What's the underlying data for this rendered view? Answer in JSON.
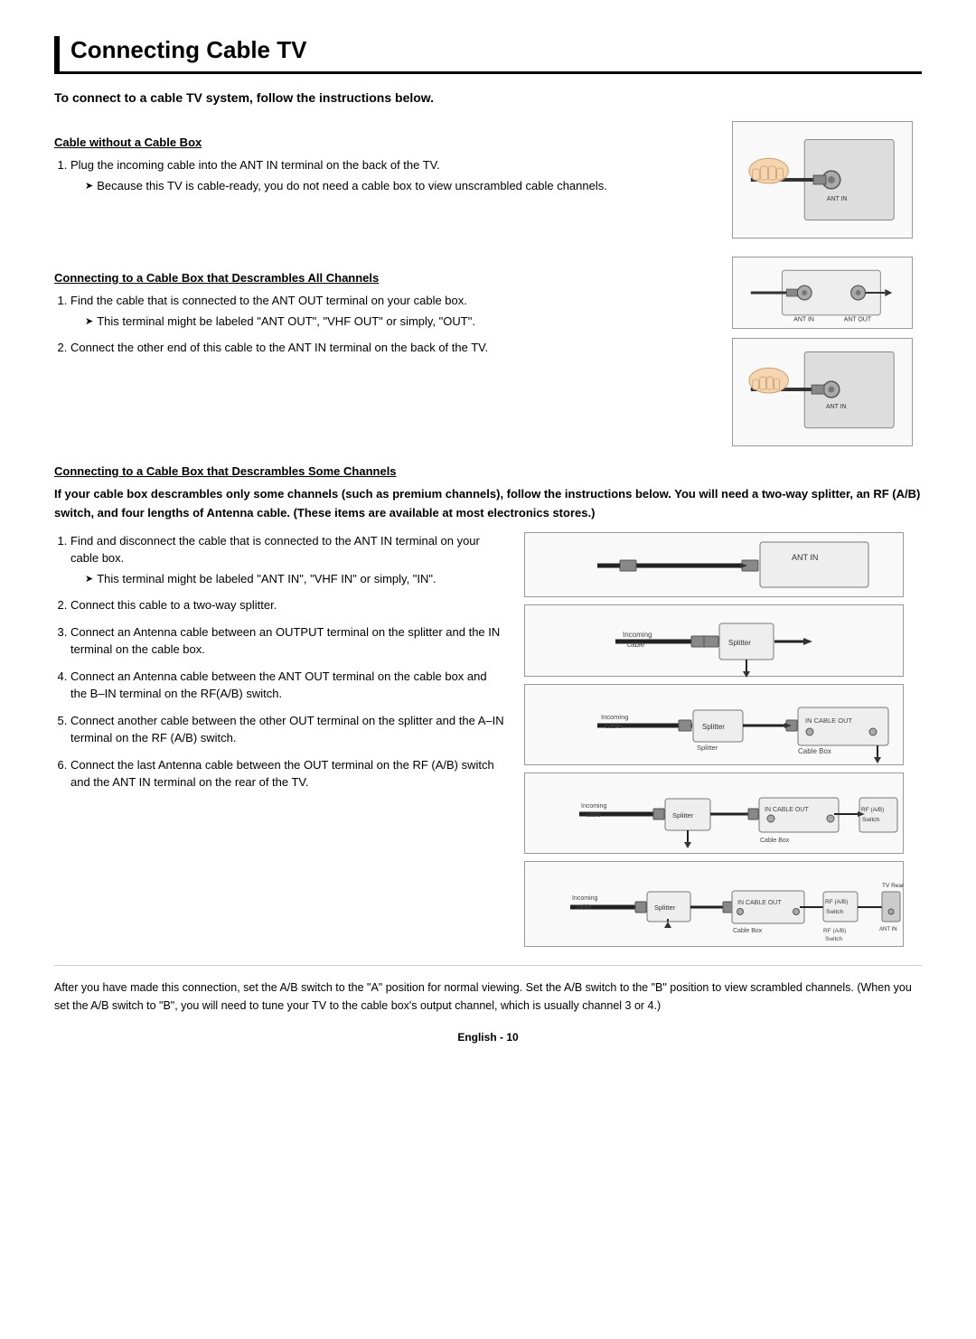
{
  "page": {
    "title": "Connecting Cable TV",
    "intro": "To connect to a cable TV system, follow the instructions below.",
    "section1": {
      "title": "Cable without a Cable Box",
      "steps": [
        {
          "number": "1",
          "text": "Plug the incoming cable into the ANT IN terminal on the back of the TV.",
          "note": "Because this TV is cable-ready, you do not need a cable box to view unscrambled cable channels."
        }
      ]
    },
    "section2": {
      "title": "Connecting to a Cable Box that Descrambles All Channels",
      "steps": [
        {
          "number": "1",
          "text": "Find the cable that is connected to the ANT OUT terminal on your cable box.",
          "note": "This terminal might be labeled \"ANT OUT\", \"VHF OUT\" or simply, \"OUT\"."
        },
        {
          "number": "2",
          "text": "Connect the other end of this cable to the ANT IN terminal on the back of the TV."
        }
      ]
    },
    "section3": {
      "title": "Connecting to a Cable Box that Descrambles Some Channels",
      "warning": "If your cable box descrambles only some channels (such as premium channels), follow the instructions below. You will need a two-way splitter, an RF (A/B) switch, and four lengths of Antenna cable. (These items are available at most electronics stores.)",
      "steps": [
        {
          "number": "1",
          "text": "Find and disconnect the cable that is connected to the ANT IN terminal on your cable box.",
          "note": "This terminal might be labeled \"ANT IN\", \"VHF IN\" or simply, \"IN\"."
        },
        {
          "number": "2",
          "text": "Connect this cable to a two-way splitter."
        },
        {
          "number": "3",
          "text": "Connect an Antenna cable between an OUTPUT terminal on the splitter and the IN terminal on the cable box."
        },
        {
          "number": "4",
          "text": "Connect an Antenna cable between the ANT OUT terminal on the cable box and the B–IN terminal on the RF(A/B) switch."
        },
        {
          "number": "5",
          "text": "Connect another cable between the other OUT terminal on the splitter and the A–IN terminal on the RF (A/B) switch."
        },
        {
          "number": "6",
          "text": "Connect the last Antenna cable between the OUT terminal on the RF (A/B) switch and the ANT IN terminal on the rear of the TV."
        }
      ]
    },
    "footer": "After you have made this connection, set the A/B switch to the \"A\" position for normal viewing. Set the A/B switch to the \"B\" position to view scrambled channels. (When you set the A/B switch to \"B\", you will need to tune your TV to the cable box's output channel, which is usually channel 3 or 4.)",
    "page_number": "English - 10",
    "diagram_labels": {
      "ant_in": "ANT IN",
      "ant_out": "ANT OUT",
      "incoming_cable": "Incoming cable",
      "splitter": "Splitter",
      "cable_box": "Cable Box",
      "rf_ab": "RF (A/B) Switch",
      "tv_rear": "TV Rear"
    }
  }
}
